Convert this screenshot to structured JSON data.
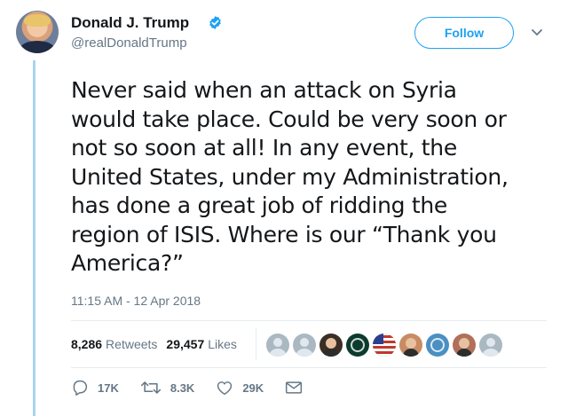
{
  "author": {
    "name": "Donald J. Trump",
    "handle": "@realDonaldTrump",
    "verified_icon": "verified-badge-icon"
  },
  "follow_label": "Follow",
  "menu_icon": "chevron-down-icon",
  "tweet": {
    "text": "Never said when an attack on Syria\nwould take place. Could be very soon or\nnot so soon at all! In any event, the\nUnited States, under my Administration,\nhas done a great job of ridding the\nregion of ISIS. Where is our “Thank you\nAmerica?”"
  },
  "timestamp": "11:15 AM - 12 Apr 2018",
  "stats": {
    "retweets_count": "8,286",
    "retweets_label": "Retweets",
    "likes_count": "29,457",
    "likes_label": "Likes"
  },
  "likers": [
    {
      "icon": "default-avatar-icon",
      "color": "#aab8c2"
    },
    {
      "icon": "default-avatar-icon",
      "color": "#aab8c2"
    },
    {
      "icon": "person-photo-icon",
      "color": "#3a2e26"
    },
    {
      "icon": "emblem-avatar-icon",
      "color": "#0c3b2e"
    },
    {
      "icon": "us-flag-avatar-icon",
      "color": "#3c5aa6"
    },
    {
      "icon": "person-photo-icon",
      "color": "#c88b64"
    },
    {
      "icon": "emblem-avatar-icon",
      "color": "#4a90c2"
    },
    {
      "icon": "person-photo-icon",
      "color": "#b0705a"
    },
    {
      "icon": "default-avatar-icon",
      "color": "#aab8c2"
    }
  ],
  "actions": {
    "reply_count": "17K",
    "retweet_count": "8.3K",
    "like_count": "29K",
    "reply_icon": "reply-icon",
    "retweet_icon": "retweet-icon",
    "like_icon": "heart-icon",
    "dm_icon": "envelope-icon"
  },
  "colors": {
    "accent": "#1da1f2",
    "muted": "#657786",
    "thread_line": "#a8d4f0"
  }
}
